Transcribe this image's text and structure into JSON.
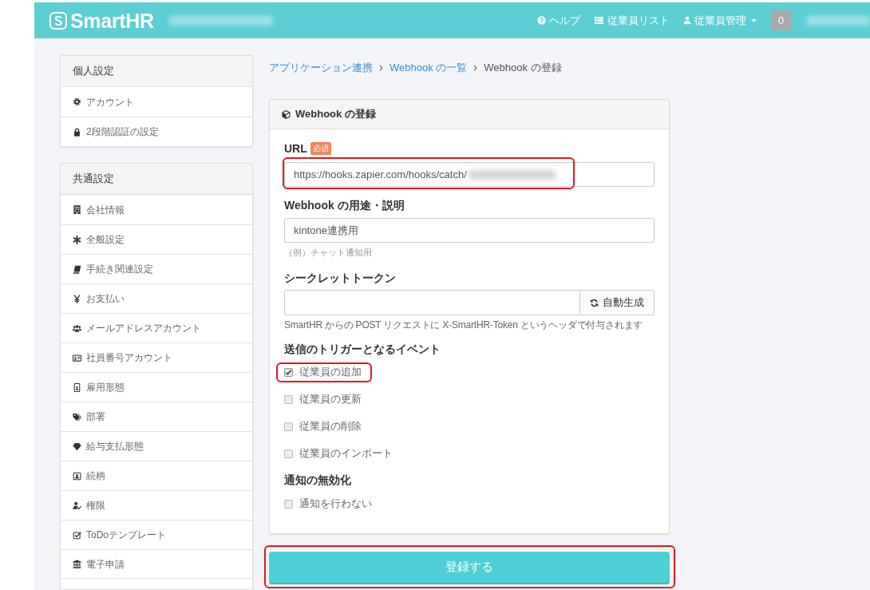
{
  "header": {
    "logo": "SmartHR",
    "nav": [
      {
        "label": "ヘルプ",
        "dropdown": false
      },
      {
        "label": "従業員リスト",
        "dropdown": false
      },
      {
        "label": "従業員管理",
        "dropdown": true
      }
    ],
    "badge": "0"
  },
  "sidebar": {
    "sections": [
      {
        "title": "個人設定",
        "items": [
          {
            "label": "アカウント"
          },
          {
            "label": "2段階認証の設定"
          }
        ]
      },
      {
        "title": "共通設定",
        "items": [
          {
            "label": "会社情報"
          },
          {
            "label": "全般設定"
          },
          {
            "label": "手続き関連設定"
          },
          {
            "label": "お支払い"
          },
          {
            "label": "メールアドレスアカウント"
          },
          {
            "label": "社員番号アカウント"
          },
          {
            "label": "雇用形態"
          },
          {
            "label": "部署"
          },
          {
            "label": "給与支払形態"
          },
          {
            "label": "続柄"
          },
          {
            "label": "権限"
          },
          {
            "label": "ToDoテンプレート"
          },
          {
            "label": "電子申請"
          }
        ]
      }
    ]
  },
  "breadcrumb": [
    {
      "label": "アプリケーション連携",
      "link": true
    },
    {
      "label": "Webhook の一覧",
      "link": true
    },
    {
      "label": "Webhook の登録",
      "link": false
    }
  ],
  "panel": {
    "title": "Webhook の登録",
    "url_field": {
      "label": "URL",
      "badge": "必須",
      "value": "https://hooks.zapier.com/hooks/catch/",
      "highlighted": true
    },
    "description_field": {
      "label": "Webhook の用途・説明",
      "value": "kintone連携用",
      "help": "（例）チャット通知用"
    },
    "token_field": {
      "label": "シークレットトークン",
      "button": "自動生成",
      "help": "SmartHR からの POST リクエストに X-SmartHR-Token というヘッダで付与されます"
    },
    "trigger_events": {
      "label": "送信のトリガーとなるイベント",
      "options": [
        {
          "label": "従業員の追加",
          "checked": true,
          "highlighted": true
        },
        {
          "label": "従業員の更新",
          "checked": false,
          "highlighted": false
        },
        {
          "label": "従業員の削除",
          "checked": false,
          "highlighted": false
        },
        {
          "label": "従業員のインポート",
          "checked": false,
          "highlighted": false
        }
      ]
    },
    "notification": {
      "label": "通知の無効化",
      "options": [
        {
          "label": "通知を行わない",
          "checked": false,
          "highlighted": false
        }
      ]
    }
  },
  "submit_button": {
    "label": "登録する",
    "highlighted": true
  }
}
